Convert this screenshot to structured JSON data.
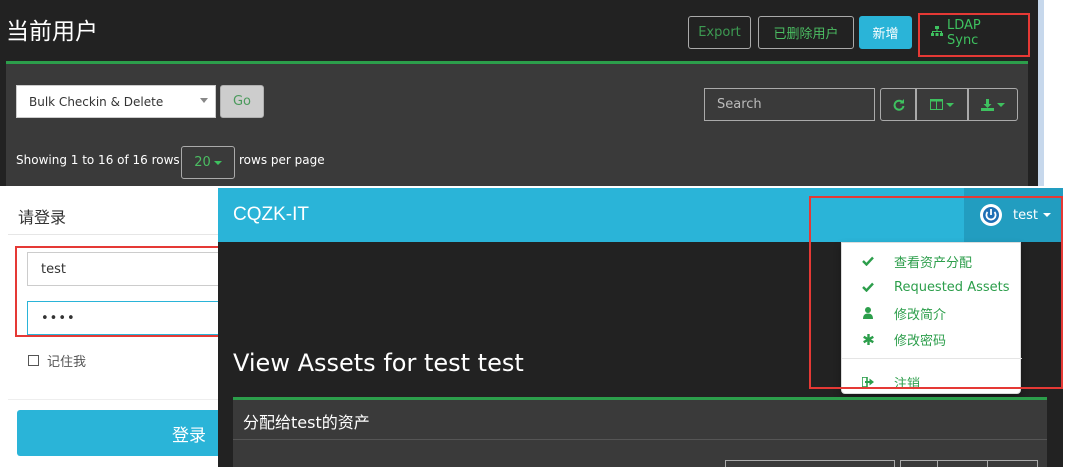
{
  "users_page": {
    "title": "当前用户",
    "header_buttons": {
      "export": "Export",
      "deleted_users": "已删除用户",
      "new": "新增",
      "ldap_sync": "LDAP Sync"
    },
    "bulk_action": "Bulk Checkin & Delete",
    "go": "Go",
    "search_placeholder": "Search",
    "pagination": {
      "showing": "Showing 1 to 16 of 16 rows",
      "page_size": "20",
      "rows_per_page": "rows per page"
    }
  },
  "login": {
    "heading": "请登录",
    "username": "test",
    "password_masked": "••••",
    "remember_me": "记住我",
    "submit": "登录"
  },
  "user_view": {
    "brand": "CQZK-IT",
    "username": "test",
    "menu": [
      {
        "icon": "check-icon",
        "label": "查看资产分配"
      },
      {
        "icon": "check-icon",
        "label": "Requested Assets"
      },
      {
        "icon": "user-icon",
        "label": "修改简介"
      },
      {
        "icon": "asterisk-icon",
        "label": "修改密码"
      },
      {
        "icon": "sign-out-icon",
        "label": "注销"
      }
    ],
    "page_title": "View Assets for test test",
    "assets_heading": "分配给test的资产"
  },
  "colors": {
    "dark_bg": "#222222",
    "panel_bg": "#3a3a3a",
    "accent_blue": "#2ab4d8",
    "accent_green": "#2c9e4b",
    "highlight_red": "#e53935"
  }
}
